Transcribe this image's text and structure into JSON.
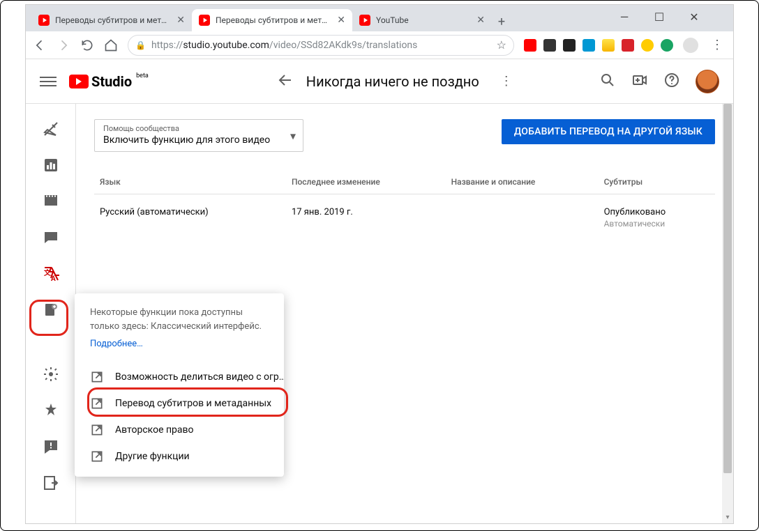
{
  "browser": {
    "tabs": [
      {
        "title": "Переводы субтитров и метадан…",
        "active": false
      },
      {
        "title": "Переводы субтитров и метадан…",
        "active": true
      },
      {
        "title": "YouTube",
        "active": false
      }
    ],
    "url_host": "https://",
    "url_domain": "studio.youtube.com",
    "url_path": "/video/SSd82AKdk9s/translations"
  },
  "header": {
    "logo_text": "Studio",
    "logo_beta": "beta",
    "title": "Никогда ничего не поздно"
  },
  "dropdown": {
    "label": "Помощь сообщества",
    "value": "Включить функцию для этого видео"
  },
  "primary_button": "ДОБАВИТЬ ПЕРЕВОД НА ДРУГОЙ ЯЗЫК",
  "table": {
    "headers": {
      "lang": "Язык",
      "modified": "Последнее изменение",
      "title_desc": "Название и описание",
      "subtitles": "Субтитры"
    },
    "rows": [
      {
        "lang": "Русский (автоматически)",
        "modified": "17 янв. 2019 г.",
        "title_desc": "",
        "subtitles_status": "Опубликовано",
        "subtitles_detail": "Автоматически"
      }
    ]
  },
  "flyout": {
    "text": "Некоторые функции пока доступны только здесь: Классический интерфейс.",
    "link": "Подробнее…",
    "items": [
      "Возможность делиться видео с огр…",
      "Перевод субтитров и метаданных",
      "Авторское право",
      "Другие функции"
    ]
  }
}
